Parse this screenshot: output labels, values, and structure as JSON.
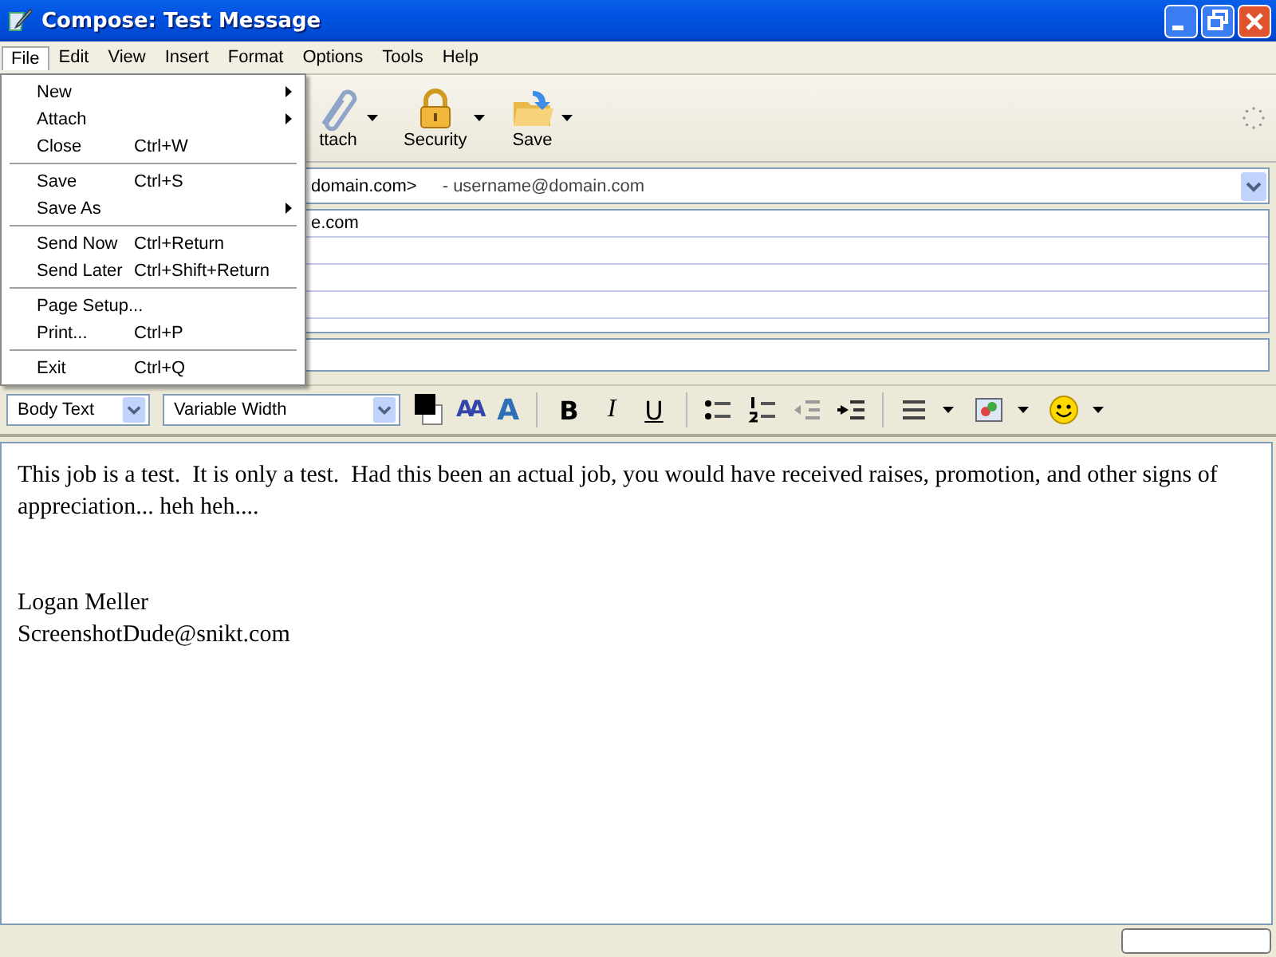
{
  "window": {
    "title": "Compose: Test Message"
  },
  "menu_bar": [
    {
      "label": "File",
      "selected": true
    },
    {
      "label": "Edit",
      "selected": false
    },
    {
      "label": "View",
      "selected": false
    },
    {
      "label": "Insert",
      "selected": false
    },
    {
      "label": "Format",
      "selected": false
    },
    {
      "label": "Options",
      "selected": false
    },
    {
      "label": "Tools",
      "selected": false
    },
    {
      "label": "Help",
      "selected": false
    }
  ],
  "file_menu": [
    [
      {
        "label": "New",
        "submenu": true
      },
      {
        "label": "Attach",
        "submenu": true
      },
      {
        "label": "Close",
        "shortcut": "Ctrl+W",
        "submenu": false
      }
    ],
    [
      {
        "label": "Save",
        "shortcut": "Ctrl+S",
        "submenu": false
      },
      {
        "label": "Save As",
        "submenu": true
      }
    ],
    [
      {
        "label": "Send Now",
        "shortcut": "Ctrl+Return",
        "submenu": false
      },
      {
        "label": "Send Later",
        "shortcut": "Ctrl+Shift+Return",
        "submenu": false
      }
    ],
    [
      {
        "label": "Page Setup...",
        "submenu": false
      },
      {
        "label": "Print...",
        "shortcut": "Ctrl+P",
        "submenu": false
      }
    ],
    [
      {
        "label": "Exit",
        "shortcut": "Ctrl+Q",
        "submenu": false
      }
    ]
  ],
  "toolbar": [
    {
      "label": "ttach",
      "kind": "paperclip"
    },
    {
      "label": "Security",
      "kind": "lock"
    },
    {
      "label": "Save",
      "kind": "folder"
    }
  ],
  "from": {
    "value": "domain.com>",
    "identity": "- username@domain.com"
  },
  "recipients": [
    "e.com"
  ],
  "format_toolbar": {
    "paragraph_style": "Body Text",
    "font": "Variable Width",
    "size_buttons": [
      {
        "label": "AA",
        "kind": "smaller"
      },
      {
        "label": "A",
        "kind": "larger"
      }
    ],
    "style_buttons": [
      {
        "label": "B",
        "kind": "bold"
      },
      {
        "label": "I",
        "kind": "italic"
      },
      {
        "label": "U",
        "kind": "underline"
      }
    ]
  },
  "body": {
    "paragraph": "This job is a test.  It is only a test.  Had this been an actual job, you would have received raises, promotion, and other signs of appreciation... heh heh....",
    "signature": [
      "Logan Meller",
      "ScreenshotDude@snikt.com"
    ]
  }
}
